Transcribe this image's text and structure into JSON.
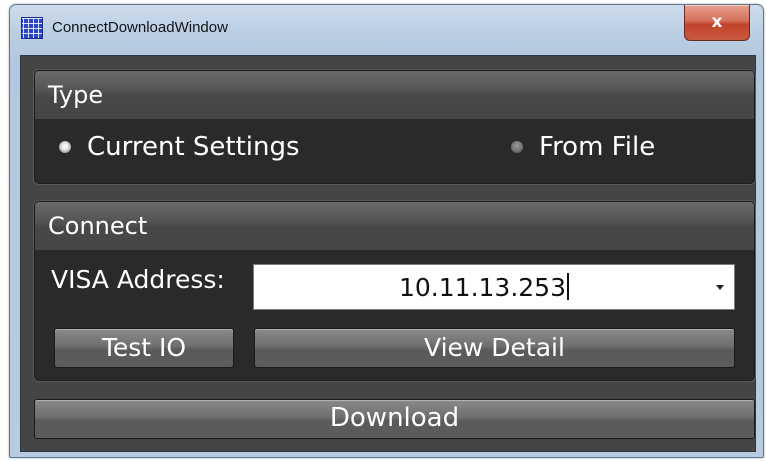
{
  "window": {
    "title": "ConnectDownloadWindow",
    "close_label": "x"
  },
  "type_group": {
    "title": "Type",
    "options": [
      {
        "label": "Current Settings",
        "checked": true
      },
      {
        "label": "From File",
        "checked": false
      }
    ]
  },
  "connect_group": {
    "title": "Connect",
    "visa_label": "VISA Address:",
    "visa_value": "10.11.13.253",
    "test_io_label": "Test IO",
    "view_detail_label": "View Detail"
  },
  "download_label": "Download",
  "colors": {
    "panel_bg": "#454545",
    "group_bg": "#2a2a2a",
    "text": "#ffffff",
    "title_bar": "#b8cbe0",
    "close_red": "#c1432c"
  }
}
